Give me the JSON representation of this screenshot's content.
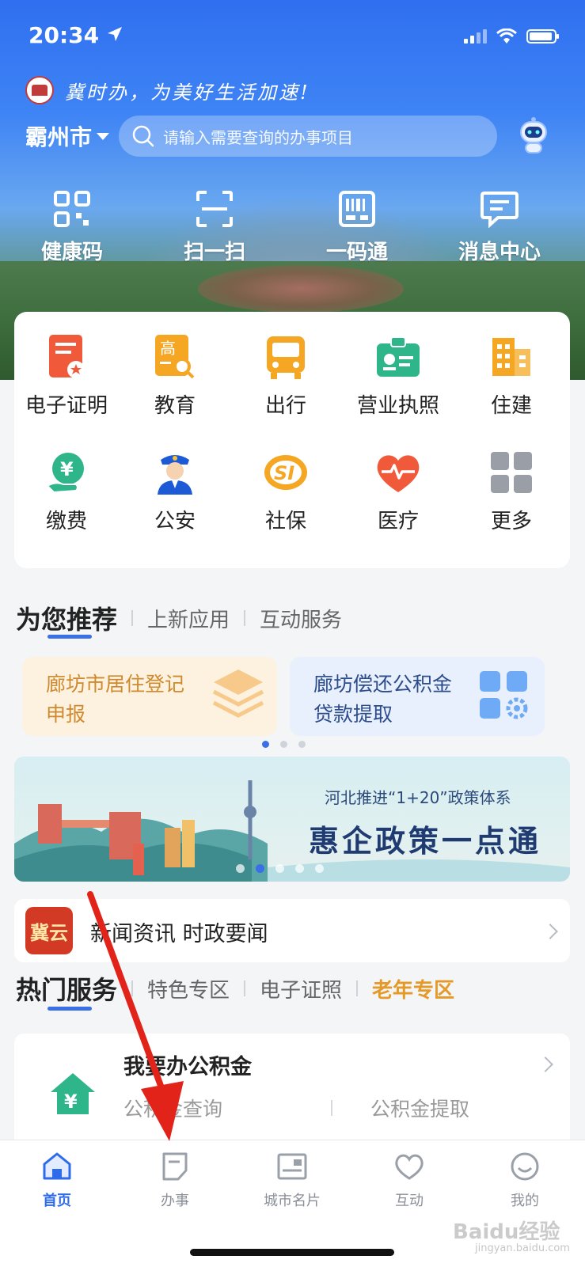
{
  "status": {
    "time": "20:34"
  },
  "header": {
    "slogan": "冀时办，为美好生活加速!",
    "city": "霸州市",
    "search_placeholder": "请输入需要查询的办事项目"
  },
  "quick_actions": [
    {
      "label": "健康码",
      "icon": "qr-grid-icon"
    },
    {
      "label": "扫一扫",
      "icon": "scan-icon"
    },
    {
      "label": "一码通",
      "icon": "barcode-icon"
    },
    {
      "label": "消息中心",
      "icon": "message-icon"
    }
  ],
  "services": [
    {
      "label": "电子证明",
      "icon": "certificate-icon"
    },
    {
      "label": "教育",
      "icon": "education-icon"
    },
    {
      "label": "出行",
      "icon": "bus-icon"
    },
    {
      "label": "营业执照",
      "icon": "license-icon"
    },
    {
      "label": "住建",
      "icon": "building-icon"
    },
    {
      "label": "缴费",
      "icon": "payment-icon"
    },
    {
      "label": "公安",
      "icon": "police-icon"
    },
    {
      "label": "社保",
      "icon": "social-security-icon"
    },
    {
      "label": "医疗",
      "icon": "medical-heart-icon"
    },
    {
      "label": "更多",
      "icon": "more-grid-icon"
    }
  ],
  "recommend_tabs": [
    "为您推荐",
    "上新应用",
    "互动服务"
  ],
  "recommend_cards": [
    {
      "line1": "廊坊市居住登记",
      "line2": "申报"
    },
    {
      "line1": "廊坊偿还公积金",
      "line2": "贷款提取"
    }
  ],
  "banner": {
    "subtitle": "河北推进“1+20”政策体系",
    "title": "惠企政策一点通"
  },
  "news": {
    "logo": "冀云",
    "text": "新闻资讯 时政要闻"
  },
  "hot_tabs": [
    "热门服务",
    "特色专区",
    "电子证照",
    "老年专区"
  ],
  "hot_service": {
    "title": "我要办公积金",
    "link1": "公积金查询",
    "link2": "公积金提取"
  },
  "tabbar": [
    "首页",
    "办事",
    "城市名片",
    "互动",
    "我的"
  ],
  "colors": {
    "primary": "#2d6bea",
    "accent_orange": "#e59a28",
    "annotation_arrow": "#e2231a"
  },
  "watermark": {
    "brand": "Baidu经验",
    "url": "jingyan.baidu.com"
  }
}
